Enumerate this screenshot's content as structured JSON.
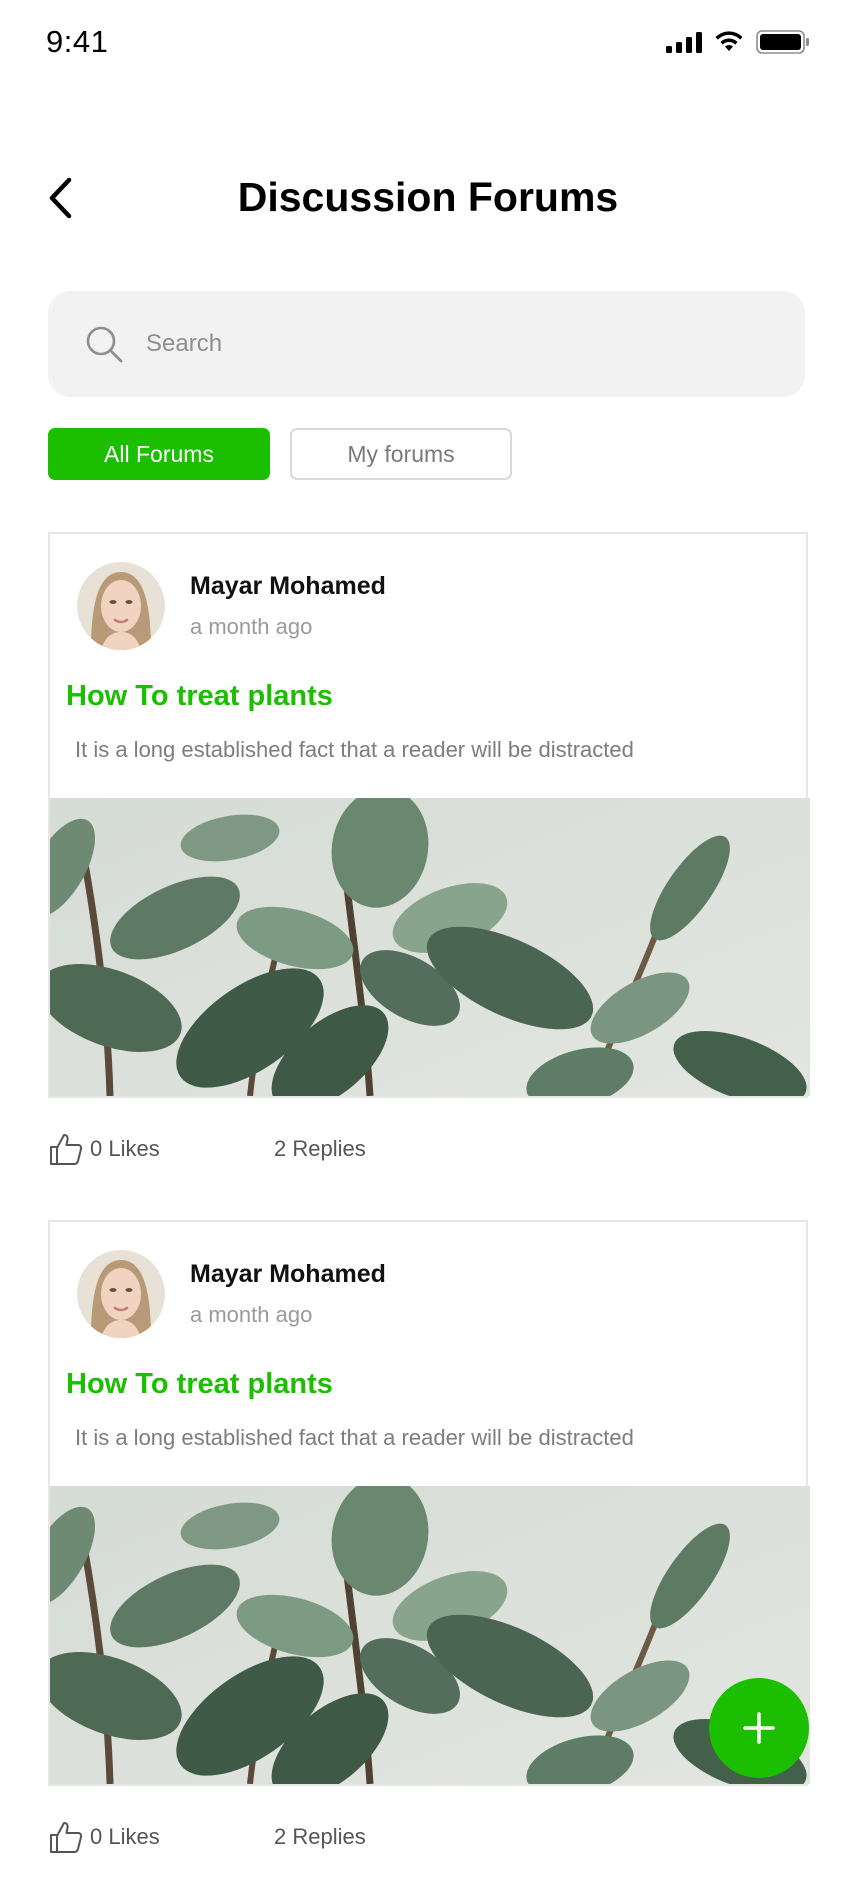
{
  "status_bar": {
    "time": "9:41"
  },
  "header": {
    "title": "Discussion Forums"
  },
  "search": {
    "placeholder": "Search"
  },
  "tabs": [
    {
      "label": "All Forums",
      "active": true
    },
    {
      "label": "My forums",
      "active": false
    }
  ],
  "posts": [
    {
      "author": "Mayar Mohamed",
      "time": "a month ago",
      "title": "How To treat plants",
      "excerpt": "It is a long established fact that a reader will be distracted",
      "likes": "0 Likes",
      "replies": "2 Replies"
    },
    {
      "author": "Mayar Mohamed",
      "time": "a month ago",
      "title": "How To treat plants",
      "excerpt": "It is a long established fact that a reader will be distracted",
      "likes": "0 Likes",
      "replies": "2 Replies"
    }
  ],
  "icons": {
    "back": "chevron-left-icon",
    "search": "search-icon",
    "like": "thumbs-up-icon",
    "add": "plus-icon",
    "signal": "cellular-signal-icon",
    "wifi": "wifi-icon",
    "battery": "battery-icon"
  },
  "colors": {
    "accent": "#1bbf00",
    "search_bg": "#f2f2f2",
    "muted_text": "#9a9a9a"
  }
}
